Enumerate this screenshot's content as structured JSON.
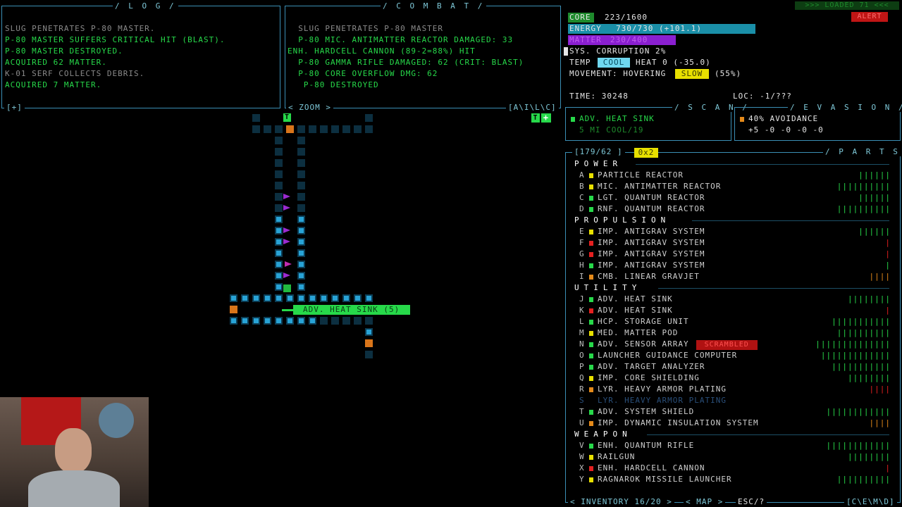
{
  "log": {
    "header": "/ L O G /",
    "lines": [
      {
        "text": "SLUG PENETRATES P-80 MASTER.",
        "c": "dg"
      },
      {
        "text": "P-80 MASTER SUFFERS CRITICAL HIT (BLAST).",
        "c": "g"
      },
      {
        "text": "P-80 MASTER DESTROYED.",
        "c": "g"
      },
      {
        "text": "ACQUIRED 62 MATTER.",
        "c": "g"
      },
      {
        "text": "K-01 SERF COLLECTS DEBRIS.",
        "c": "dg"
      },
      {
        "text": "ACQUIRED 7 MATTER.",
        "c": "g"
      }
    ],
    "footer": "[+]"
  },
  "combat": {
    "header": "/ C O M B A T /",
    "lines": [
      {
        "text": "  SLUG PENETRATES P-80 MASTER",
        "c": "dg"
      },
      {
        "text": "  P-80 MIC. ANTIMATTER REACTOR DAMAGED: 33",
        "c": "g"
      },
      {
        "text": "ENH. HARDCELL CANNON (89-2=88%) HIT",
        "c": "g"
      },
      {
        "text": "  P-80 GAMMA RIFLE DAMAGED: 62 (CRIT: BLAST)",
        "c": "g"
      },
      {
        "text": "  P-80 CORE OVERFLOW DMG: 62",
        "c": "g"
      },
      {
        "text": "   P-80 DESTROYED",
        "c": "g"
      }
    ],
    "footer_left": "< ZOOM >",
    "footer_right": "[A\\I\\L\\C]"
  },
  "status": {
    "loaded": ">>> LOADED 71 <<<",
    "alert": "ALERT",
    "core_label": "CORE",
    "core_val": "223/1600",
    "energy_label": "ENERGY",
    "energy_val": "730/730 (+101.1)",
    "matter_label": "MATTER",
    "matter_val": "230/400",
    "corruption": "SYS. CORRUPTION 2%",
    "temp_label": "TEMP",
    "temp_state": "COOL",
    "heat": "HEAT 0 (-35.0)",
    "movement_label": "MOVEMENT: HOVERING",
    "movement_state": "SLOW",
    "movement_pct": "(55%)",
    "time": "TIME: 30248",
    "loc": "LOC: -1/???",
    "core_fill": 0.14,
    "energy_fill": 1.0,
    "matter_fill": 0.575
  },
  "scan": {
    "header": "/ S C A N /",
    "line1": "ADV. HEAT SINK",
    "line2": "5 MI COOL/19"
  },
  "evasion": {
    "header": "/ E V A S I O N /",
    "line1": "40% AVOIDANCE",
    "line2": "+5 -0 -0 -0 -0"
  },
  "parts": {
    "header": "/ P A R T S /",
    "slots": "[179/62 ]",
    "multiplier": "0x2",
    "sections": [
      {
        "title": "POWER",
        "items": [
          {
            "key": "A",
            "name": "PARTICLE REACTOR",
            "sq": "yl",
            "bars": "||||||",
            "bc": "g"
          },
          {
            "key": "B",
            "name": "MIC. ANTIMATTER REACTOR",
            "sq": "yl",
            "bars": "||||||||||",
            "bc": "g"
          },
          {
            "key": "C",
            "name": "LGT. QUANTUM REACTOR",
            "sq": "g",
            "bars": "||||||",
            "bc": "g"
          },
          {
            "key": "D",
            "name": "RNF. QUANTUM REACTOR",
            "sq": "g",
            "bars": "||||||||||",
            "bc": "g"
          }
        ]
      },
      {
        "title": "PROPULSION",
        "items": [
          {
            "key": "E",
            "name": "IMP. ANTIGRAV SYSTEM",
            "sq": "yl",
            "bars": "||||||",
            "bc": "g"
          },
          {
            "key": "F",
            "name": "IMP. ANTIGRAV SYSTEM",
            "sq": "rd",
            "bars": "|",
            "bc": "rd"
          },
          {
            "key": "G",
            "name": "IMP. ANTIGRAV SYSTEM",
            "sq": "rd",
            "bars": "|",
            "bc": "rd"
          },
          {
            "key": "H",
            "name": "IMP. ANTIGRAV SYSTEM",
            "sq": "g",
            "bars": "|",
            "bc": "g"
          },
          {
            "key": "I",
            "name": "CMB. LINEAR GRAVJET",
            "sq": "or",
            "bars": "||||",
            "bc": "or"
          }
        ]
      },
      {
        "title": "UTILITY",
        "items": [
          {
            "key": "J",
            "name": "ADV. HEAT SINK",
            "sq": "g",
            "bars": "||||||||",
            "bc": "g"
          },
          {
            "key": "K",
            "name": "ADV. HEAT SINK",
            "sq": "rd",
            "bars": "|",
            "bc": "rd"
          },
          {
            "key": "L",
            "name": "HCP. STORAGE UNIT",
            "sq": "g",
            "bars": "|||||||||||",
            "bc": "g"
          },
          {
            "key": "M",
            "name": "MED. MATTER POD",
            "sq": "yl",
            "bars": "||||||||||",
            "bc": "g"
          },
          {
            "key": "N",
            "name": "ADV. SENSOR ARRAY",
            "sq": "g",
            "bars": "||||||||||||||",
            "bc": "g",
            "tag": "SCRAMBLED"
          },
          {
            "key": "O",
            "name": "LAUNCHER GUIDANCE COMPUTER",
            "sq": "g",
            "bars": "|||||||||||||",
            "bc": "g"
          },
          {
            "key": "P",
            "name": "ADV. TARGET ANALYZER",
            "sq": "g",
            "bars": "|||||||||||",
            "bc": "g"
          },
          {
            "key": "Q",
            "name": "IMP. CORE SHIELDING",
            "sq": "yl",
            "bars": "||||||||",
            "bc": "g"
          },
          {
            "key": "R",
            "name": "LYR. HEAVY ARMOR PLATING",
            "sq": "or",
            "bars": "||||",
            "bc": "rd"
          },
          {
            "key": "S",
            "name": "LYR. HEAVY ARMOR PLATING",
            "sq": "",
            "bars": "",
            "bc": "g",
            "dim": true
          },
          {
            "key": "T",
            "name": "ADV. SYSTEM SHIELD",
            "sq": "g",
            "bars": "||||||||||||",
            "bc": "g"
          },
          {
            "key": "U",
            "name": "IMP. DYNAMIC INSULATION SYSTEM",
            "sq": "or",
            "bars": "||||",
            "bc": "or"
          }
        ]
      },
      {
        "title": "WEAPON",
        "items": [
          {
            "key": "V",
            "name": "ENH. QUANTUM RIFLE",
            "sq": "g",
            "bars": "||||||||||||",
            "bc": "g"
          },
          {
            "key": "W",
            "name": "RAILGUN",
            "sq": "yl",
            "bars": "||||||||",
            "bc": "g"
          },
          {
            "key": "X",
            "name": "ENH. HARDCELL CANNON",
            "sq": "rd",
            "bars": "|",
            "bc": "rd"
          },
          {
            "key": "Y",
            "name": "RAGNAROK MISSILE LAUNCHER",
            "sq": "yl",
            "bars": "||||||||||",
            "bc": "g"
          }
        ]
      }
    ]
  },
  "bottom": {
    "inventory": "< INVENTORY 16/20 >",
    "map": "< MAP >",
    "esc": "ESC/?",
    "right": "[C\\E\\M\\D]"
  },
  "map": {
    "tooltip": "ADV. HEAT SINK (5)",
    "player_glyph": "T",
    "top_marker": "T",
    "top_right_t": "T",
    "top_right_plus": "+"
  },
  "colors": {
    "frame": "#3b8fb5",
    "green": "#27d94a",
    "cyan": "#6fd7ef",
    "matter": "#8a1fd0",
    "alert": "#c01515"
  }
}
